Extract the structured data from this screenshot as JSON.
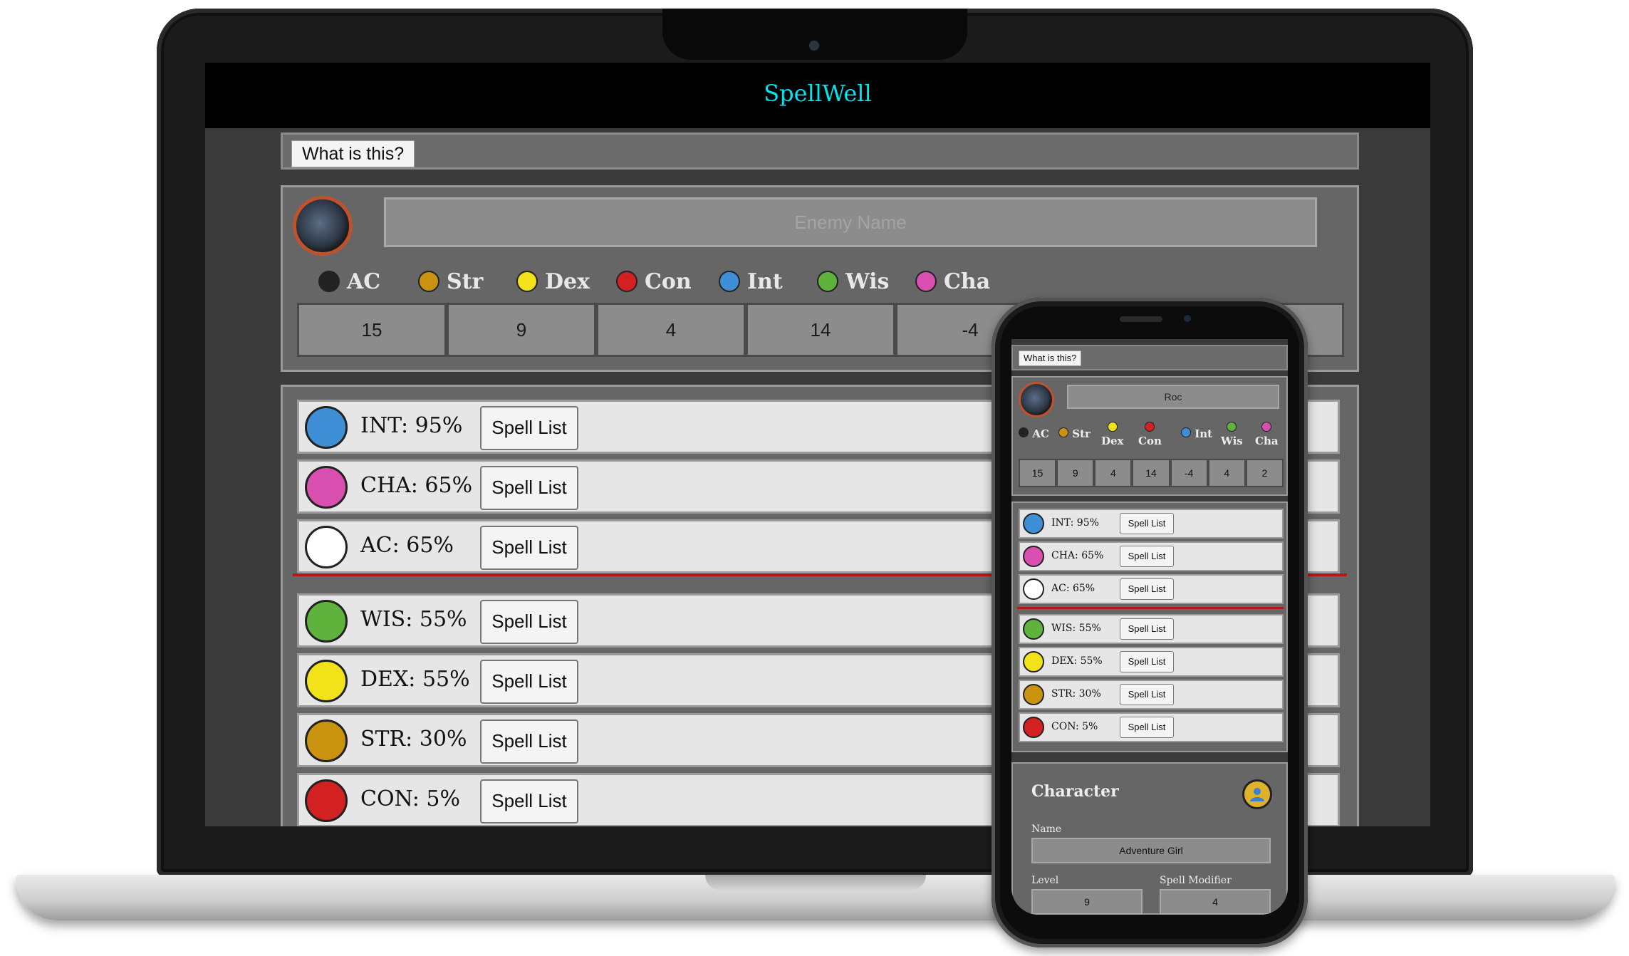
{
  "app": {
    "title": "SpellWell"
  },
  "help": {
    "label": "What is this?"
  },
  "enemy": {
    "name_placeholder": "Enemy Name",
    "stats": [
      {
        "key": "AC",
        "value": "15",
        "color": "#222222"
      },
      {
        "key": "Str",
        "value": "9",
        "color": "#c9920f"
      },
      {
        "key": "Dex",
        "value": "4",
        "color": "#f2e21a"
      },
      {
        "key": "Con",
        "value": "14",
        "color": "#d32020"
      },
      {
        "key": "Int",
        "value": "-4",
        "color": "#3f8fd6"
      },
      {
        "key": "Wis",
        "value": "",
        "color": "#5fb33c"
      },
      {
        "key": "Cha",
        "value": "",
        "color": "#d94fb0"
      }
    ]
  },
  "chances": [
    {
      "label": "INT: 95%",
      "button": "Spell List",
      "color": "#3f8fd6",
      "icon": "brain-icon"
    },
    {
      "label": "CHA: 65%",
      "button": "Spell List",
      "color": "#d94fb0",
      "icon": "masks-icon"
    },
    {
      "label": "AC: 65%",
      "button": "Spell List",
      "color": "#ffffff",
      "icon": "shield-icon"
    },
    {
      "label": "WIS: 55%",
      "button": "Spell List",
      "color": "#5fb33c",
      "icon": "owl-icon"
    },
    {
      "label": "DEX: 55%",
      "button": "Spell List",
      "color": "#f2e21a",
      "icon": "target-icon"
    },
    {
      "label": "STR: 30%",
      "button": "Spell List",
      "color": "#c9920f",
      "icon": "arm-icon"
    },
    {
      "label": "CON: 5%",
      "button": "Spell List",
      "color": "#d32020",
      "icon": "heart-icon"
    }
  ],
  "phone": {
    "help_label": "What is this?",
    "enemy_name": "Roc",
    "stats": [
      {
        "key": "AC",
        "value": "15"
      },
      {
        "key": "Str",
        "value": "9"
      },
      {
        "key": "Dex",
        "value": "4"
      },
      {
        "key": "Con",
        "value": "14"
      },
      {
        "key": "Int",
        "value": "-4"
      },
      {
        "key": "Wis",
        "value": "4"
      },
      {
        "key": "Cha",
        "value": "2"
      }
    ],
    "chances": [
      {
        "label": "INT: 95%",
        "button": "Spell List"
      },
      {
        "label": "CHA: 65%",
        "button": "Spell List"
      },
      {
        "label": "AC: 65%",
        "button": "Spell List"
      },
      {
        "label": "WIS: 55%",
        "button": "Spell List"
      },
      {
        "label": "DEX: 55%",
        "button": "Spell List"
      },
      {
        "label": "STR: 30%",
        "button": "Spell List"
      },
      {
        "label": "CON: 5%",
        "button": "Spell List"
      }
    ],
    "character": {
      "title": "Character",
      "name_label": "Name",
      "name_value": "Adventure Girl",
      "level_label": "Level",
      "level_value": "9",
      "modifier_label": "Spell Modifier",
      "modifier_value": "4"
    }
  }
}
